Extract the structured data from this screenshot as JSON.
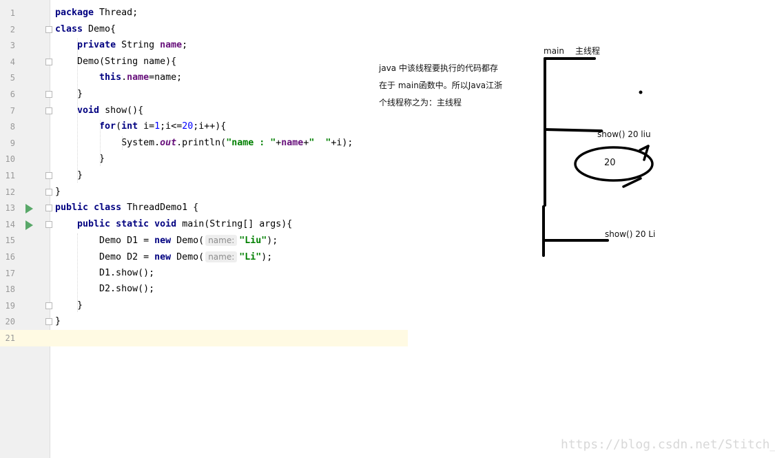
{
  "editor": {
    "lines": [
      {
        "n": "1",
        "tokens": [
          {
            "t": "package",
            "c": "kw"
          },
          {
            "t": " Thread;",
            "c": ""
          }
        ]
      },
      {
        "n": "2",
        "tokens": [
          {
            "t": "class",
            "c": "kw"
          },
          {
            "t": " Demo{",
            "c": ""
          }
        ]
      },
      {
        "n": "3",
        "tokens": [
          {
            "t": "    ",
            "c": ""
          },
          {
            "t": "private",
            "c": "kw"
          },
          {
            "t": " String ",
            "c": ""
          },
          {
            "t": "name",
            "c": "fld"
          },
          {
            "t": ";",
            "c": ""
          }
        ]
      },
      {
        "n": "4",
        "tokens": [
          {
            "t": "    Demo(String name){",
            "c": ""
          }
        ]
      },
      {
        "n": "5",
        "tokens": [
          {
            "t": "        ",
            "c": ""
          },
          {
            "t": "this",
            "c": "kw"
          },
          {
            "t": ".",
            "c": ""
          },
          {
            "t": "name",
            "c": "fld"
          },
          {
            "t": "=name;",
            "c": ""
          }
        ]
      },
      {
        "n": "6",
        "tokens": [
          {
            "t": "    }",
            "c": ""
          }
        ]
      },
      {
        "n": "7",
        "tokens": [
          {
            "t": "    ",
            "c": ""
          },
          {
            "t": "void",
            "c": "kw"
          },
          {
            "t": " show(){",
            "c": ""
          }
        ]
      },
      {
        "n": "8",
        "tokens": [
          {
            "t": "        ",
            "c": ""
          },
          {
            "t": "for",
            "c": "kw"
          },
          {
            "t": "(",
            "c": ""
          },
          {
            "t": "int",
            "c": "kw"
          },
          {
            "t": " i=",
            "c": ""
          },
          {
            "t": "1",
            "c": "num"
          },
          {
            "t": ";i<=",
            "c": ""
          },
          {
            "t": "20",
            "c": "num"
          },
          {
            "t": ";i++){",
            "c": ""
          }
        ]
      },
      {
        "n": "9",
        "tokens": [
          {
            "t": "            System.",
            "c": ""
          },
          {
            "t": "out",
            "c": "sf"
          },
          {
            "t": ".println(",
            "c": ""
          },
          {
            "t": "\"name : \"",
            "c": "st"
          },
          {
            "t": "+",
            "c": ""
          },
          {
            "t": "name",
            "c": "fld"
          },
          {
            "t": "+",
            "c": ""
          },
          {
            "t": "\"  \"",
            "c": "st"
          },
          {
            "t": "+i);",
            "c": ""
          }
        ]
      },
      {
        "n": "10",
        "tokens": [
          {
            "t": "        }",
            "c": ""
          }
        ]
      },
      {
        "n": "11",
        "tokens": [
          {
            "t": "    }",
            "c": ""
          }
        ]
      },
      {
        "n": "12",
        "tokens": [
          {
            "t": "}",
            "c": ""
          }
        ]
      },
      {
        "n": "13",
        "tokens": [
          {
            "t": "public",
            "c": "kw"
          },
          {
            "t": " ",
            "c": ""
          },
          {
            "t": "class",
            "c": "kw"
          },
          {
            "t": " ThreadDemo1 {",
            "c": ""
          }
        ]
      },
      {
        "n": "14",
        "tokens": [
          {
            "t": "    ",
            "c": ""
          },
          {
            "t": "public",
            "c": "kw"
          },
          {
            "t": " ",
            "c": ""
          },
          {
            "t": "static",
            "c": "kw"
          },
          {
            "t": " ",
            "c": ""
          },
          {
            "t": "void",
            "c": "kw"
          },
          {
            "t": " main(String[] args){",
            "c": ""
          }
        ]
      },
      {
        "n": "15",
        "tokens": [
          {
            "t": "        Demo D1 = ",
            "c": ""
          },
          {
            "t": "new",
            "c": "kw"
          },
          {
            "t": " Demo(",
            "c": ""
          },
          {
            "t": "name:",
            "c": "hint"
          },
          {
            "t": "\"Liu\"",
            "c": "st"
          },
          {
            "t": ");",
            "c": ""
          }
        ]
      },
      {
        "n": "16",
        "tokens": [
          {
            "t": "        Demo D2 = ",
            "c": ""
          },
          {
            "t": "new",
            "c": "kw"
          },
          {
            "t": " Demo(",
            "c": ""
          },
          {
            "t": "name:",
            "c": "hint"
          },
          {
            "t": "\"Li\"",
            "c": "st"
          },
          {
            "t": ");",
            "c": ""
          }
        ]
      },
      {
        "n": "17",
        "tokens": [
          {
            "t": "        D1.show();",
            "c": ""
          }
        ]
      },
      {
        "n": "18",
        "tokens": [
          {
            "t": "        D2.show();",
            "c": ""
          }
        ]
      },
      {
        "n": "19",
        "tokens": [
          {
            "t": "    }",
            "c": ""
          }
        ]
      },
      {
        "n": "20",
        "tokens": [
          {
            "t": "}",
            "c": ""
          }
        ]
      },
      {
        "n": "21",
        "tokens": []
      }
    ],
    "current_line": "21",
    "run_gutter_lines": [
      "13",
      "14"
    ],
    "fold_lines": [
      "2",
      "4",
      "6",
      "7",
      "11",
      "12",
      "13",
      "14",
      "19",
      "20"
    ],
    "colors": {
      "keyword": "#000080",
      "field": "#660e7a",
      "string": "#008000",
      "number": "#0000ff",
      "gutter": "#f0f0f0",
      "current_line": "#fffae3",
      "run_icon": "#59a869"
    }
  },
  "drawing": {
    "note_lines": [
      "java 中该线程要执行的代码都存",
      "在于 main函数中。所以Java江浙",
      "个线程称之为：主线程"
    ],
    "main_label": "main",
    "main_thread_label": "主线程",
    "show_liu_label": "show() 20  liu",
    "loop_count": "20",
    "show_li_label": "show() 20  Li",
    "watermark": "https://blog.csdn.net/Stitch__"
  }
}
